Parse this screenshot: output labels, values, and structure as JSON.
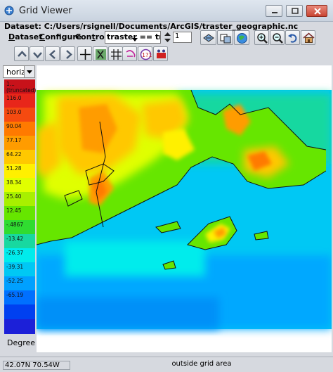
{
  "window": {
    "title": "Grid Viewer"
  },
  "dataset": {
    "label": "Dataset: C:/Users/rsignell/Documents/ArcGIS/traster_geographic.nc"
  },
  "menus": [
    {
      "label": "Dataset",
      "key": "D",
      "rest": "ataset"
    },
    {
      "label": "Configure",
      "key": "C",
      "rest": "onfigure"
    },
    {
      "label": "Controls",
      "key": "t",
      "pre": "Con",
      "rest": "rols"
    }
  ],
  "field_select": {
    "value": "traster == traster"
  },
  "level": {
    "value": "1"
  },
  "legend": {
    "variable": "horiz",
    "unit": "Degree",
    "colors": [
      "#c8121a",
      "#e8261a",
      "#f54a10",
      "#ff7a00",
      "#ff9c00",
      "#ffc800",
      "#fff000",
      "#e0ff00",
      "#a8f000",
      "#66e600",
      "#30dc30",
      "#18d8a0",
      "#00ecec",
      "#00c8f4",
      "#00a0ff",
      "#0070ff",
      "#0040f0",
      "#1c20d8"
    ],
    "labels": [
      "1... (truncated)",
      "116.0",
      "103.0",
      "90.04",
      "77.17",
      "64.22",
      "51.28",
      "38.34",
      "25.40",
      "12.45",
      "-.4867",
      "-13.42",
      "-26.37",
      "-39.31",
      "-52.25",
      "-65.19",
      "",
      ""
    ]
  },
  "status": {
    "coords": "42.07N 70.54W",
    "message": "outside grid area"
  }
}
